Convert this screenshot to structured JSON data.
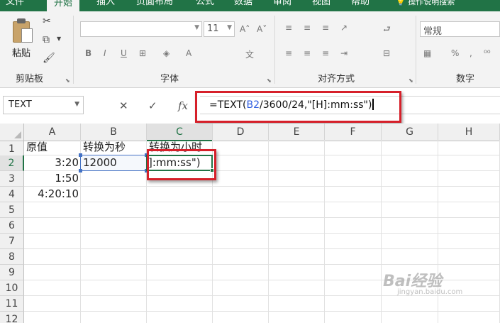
{
  "ribbon": {
    "tabs": [
      {
        "label": "文件"
      },
      {
        "label": "开始"
      },
      {
        "label": "插入"
      },
      {
        "label": "页面布局"
      },
      {
        "label": "公式"
      },
      {
        "label": "数据"
      },
      {
        "label": "审阅"
      },
      {
        "label": "视图"
      },
      {
        "label": "帮助"
      },
      {
        "label": "操作说明搜索"
      }
    ],
    "clipboard": {
      "paste_label": "粘贴",
      "group_label": "剪贴板"
    },
    "font": {
      "group_label": "字体",
      "size_value": "11",
      "bold": "B",
      "italic": "I",
      "underline": "U"
    },
    "alignment": {
      "group_label": "对齐方式"
    },
    "number": {
      "group_label": "数字",
      "format_value": "常规",
      "percent": "%",
      "comma": ","
    }
  },
  "formula_bar": {
    "name_box": "TEXT",
    "cancel_icon": "✕",
    "enter_icon": "✓",
    "fx_label": "fx",
    "formula_prefix": "=TEXT(",
    "formula_ref": "B2",
    "formula_suffix": "/3600/24,\"[H]:mm:ss\")"
  },
  "grid": {
    "columns": [
      "A",
      "B",
      "C",
      "D",
      "E",
      "F",
      "G",
      "H"
    ],
    "rows": [
      "1",
      "2",
      "3",
      "4",
      "5",
      "6",
      "7",
      "8",
      "9",
      "10",
      "11",
      "12"
    ],
    "cells": {
      "A1": "原值",
      "B1": "转换为秒",
      "C1": "转换为小时",
      "A2": "3:20",
      "B2": "12000",
      "A3": "1:50",
      "A4": "4:20:10",
      "C2_editing": "]:mm:ss\")"
    }
  },
  "watermark": {
    "brand": "Bai经验",
    "sub": "jingyan.baidu.com"
  },
  "colors": {
    "excel_green": "#217346",
    "highlight_red": "#d6202a",
    "ref_blue": "#4472c4"
  }
}
